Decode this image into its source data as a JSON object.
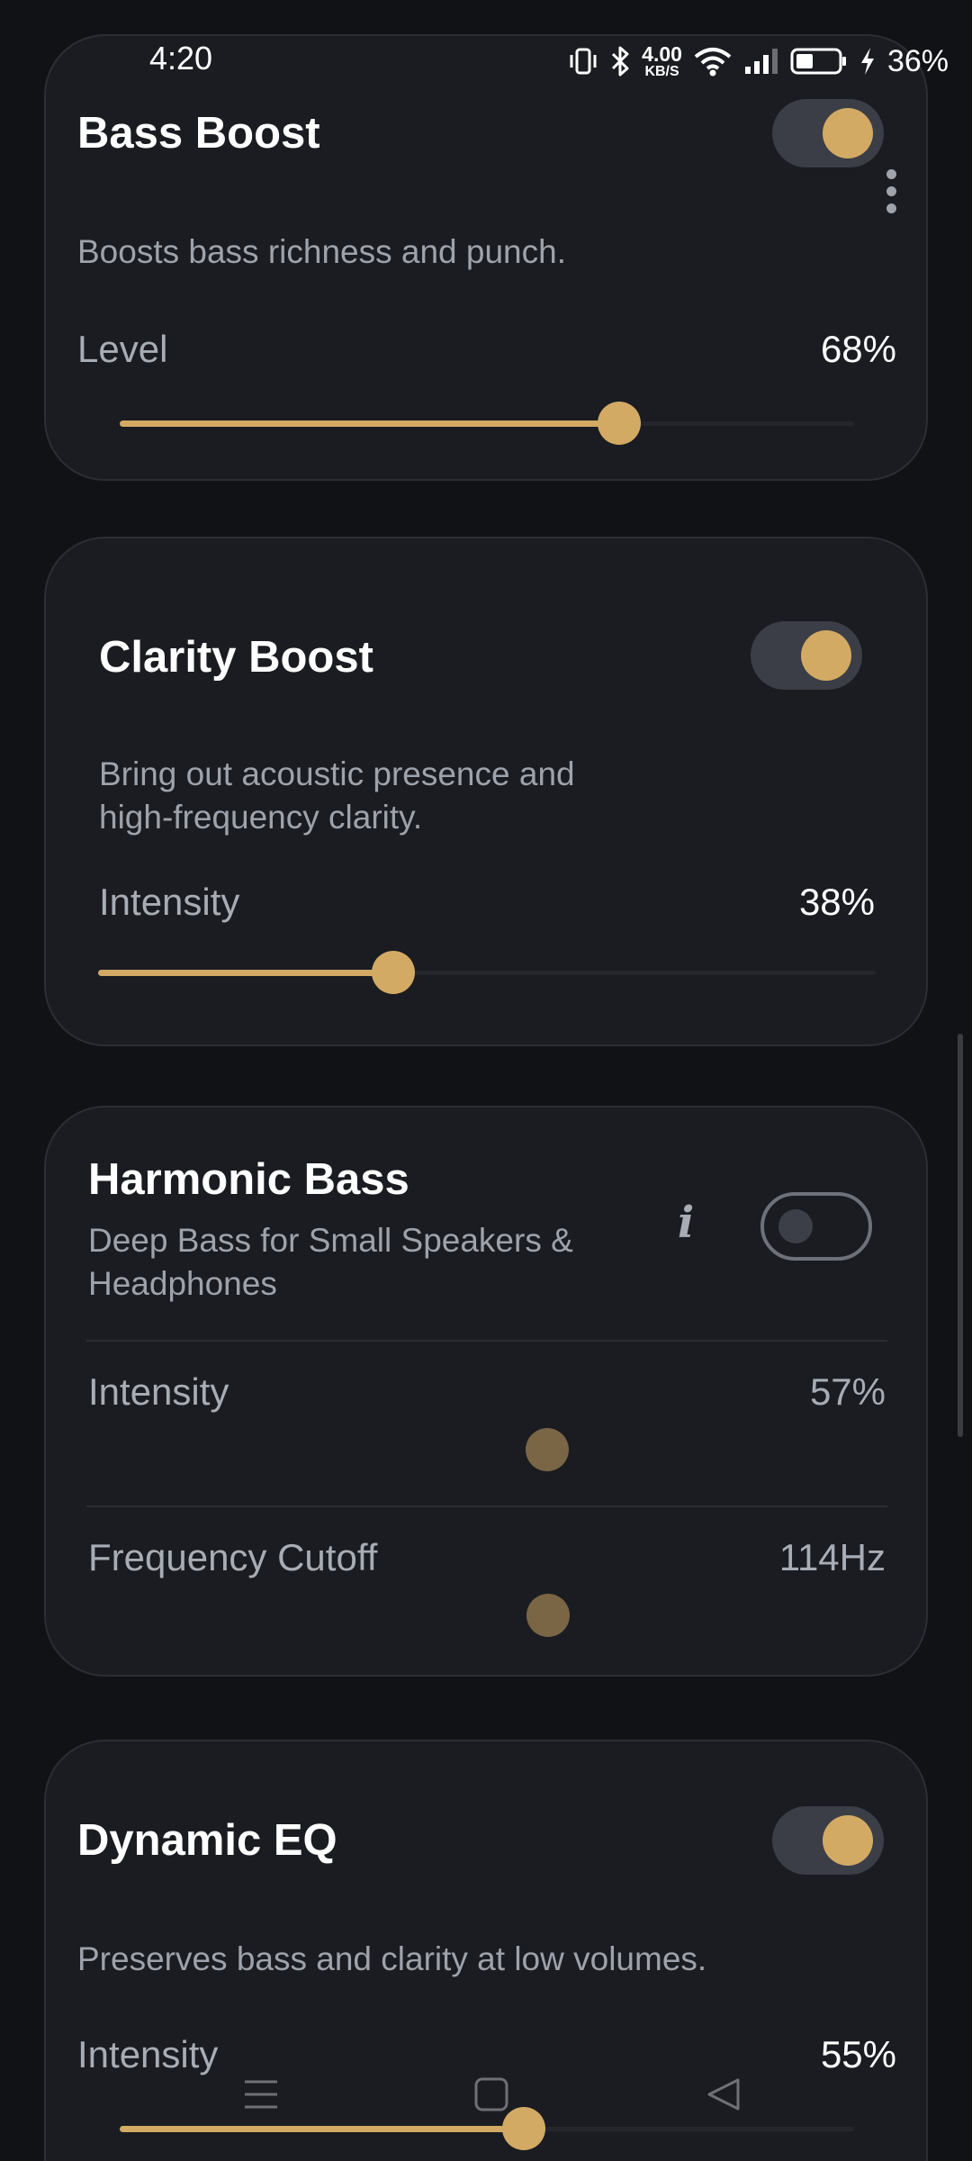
{
  "status_bar": {
    "time": "4:20",
    "net_speed_value": "4.00",
    "net_speed_unit": "KB/S",
    "battery_percent": "36%"
  },
  "cards": {
    "bass_boost": {
      "title": "Bass Boost",
      "description": "Boosts bass richness and punch.",
      "enabled": true,
      "slider_label": "Level",
      "value_text": "68%",
      "value": 0.68
    },
    "clarity_boost": {
      "title": "Clarity Boost",
      "description_line1": "Bring out acoustic presence and",
      "description_line2": "high-frequency clarity.",
      "enabled": true,
      "slider_label": "Intensity",
      "value_text": "38%",
      "value": 0.38
    },
    "harmonic_bass": {
      "title": "Harmonic Bass",
      "description_line1": "Deep Bass for Small Speakers &",
      "description_line2": "Headphones",
      "info_glyph": "i",
      "enabled": false,
      "intensity_label": "Intensity",
      "intensity_value_text": "57%",
      "intensity_value": 0.57,
      "cutoff_label": "Frequency Cutoff",
      "cutoff_value_text": "114Hz"
    },
    "dynamic_eq": {
      "title": "Dynamic EQ",
      "description": "Preserves bass and clarity at low volumes.",
      "enabled": true,
      "slider_label": "Intensity",
      "value_text": "55%",
      "value": 0.55
    }
  },
  "colors": {
    "accent": "#d3aa64",
    "card_background": "#1a1c21",
    "page_background": "#111215"
  },
  "icons": [
    "vibrate-icon",
    "bluetooth-icon",
    "wifi-icon",
    "signal-icon",
    "battery-icon",
    "charging-bolt-icon",
    "more-vert-icon",
    "info-icon",
    "nav-recents-icon",
    "nav-home-icon",
    "nav-back-icon"
  ]
}
